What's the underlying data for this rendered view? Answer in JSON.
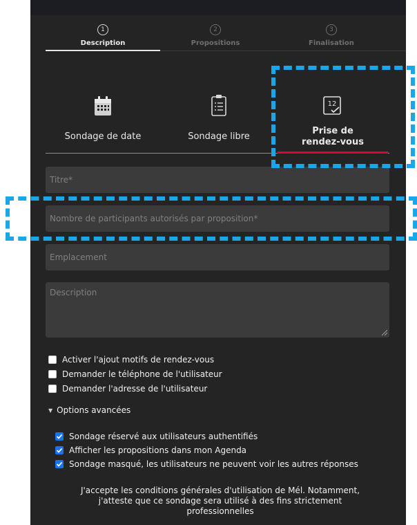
{
  "stepper": {
    "steps": [
      {
        "number": "1",
        "label": "Description"
      },
      {
        "number": "2",
        "label": "Propositions"
      },
      {
        "number": "3",
        "label": "Finalisation"
      }
    ]
  },
  "poll_types": {
    "date": {
      "label": "Sondage de date",
      "icon": "calendar-icon"
    },
    "free": {
      "label": "Sondage libre",
      "icon": "clipboard-list-icon"
    },
    "appointment": {
      "label_line1": "Prise de",
      "label_line2": "rendez-vous",
      "icon": "calendar-12-check-icon",
      "calendar_number": "12"
    }
  },
  "form": {
    "title_placeholder": "Titre*",
    "participants_placeholder": "Nombre de participants autorisés par proposition*",
    "location_placeholder": "Emplacement",
    "description_placeholder": "Description"
  },
  "checkboxes": [
    {
      "label": "Activer l'ajout motifs de rendez-vous",
      "checked": false
    },
    {
      "label": "Demander le téléphone de l'utilisateur",
      "checked": false
    },
    {
      "label": "Demander l'adresse de l'utilisateur",
      "checked": false
    }
  ],
  "advanced": {
    "toggle_label": "Options avancées",
    "options": [
      {
        "label": "Sondage réservé aux utilisateurs authentifiés",
        "checked": true
      },
      {
        "label": "Afficher les propositions dans mon Agenda",
        "checked": true
      },
      {
        "label": "Sondage masqué, les utilisateurs ne peuvent voir les autres réponses",
        "checked": true
      }
    ]
  },
  "terms": {
    "line1": "J'accepte les conditions générales d'utilisation de Mél. Notamment,",
    "line2": "j'atteste que ce sondage sera utilisé à des fins strictement",
    "line3": "professionnelles"
  },
  "colors": {
    "panel_bg": "#242424",
    "field_bg": "#3b3b3b",
    "accent_red": "#e0003a",
    "annotation_blue": "#1aa7e8",
    "checkbox_blue": "#1a73e8"
  }
}
